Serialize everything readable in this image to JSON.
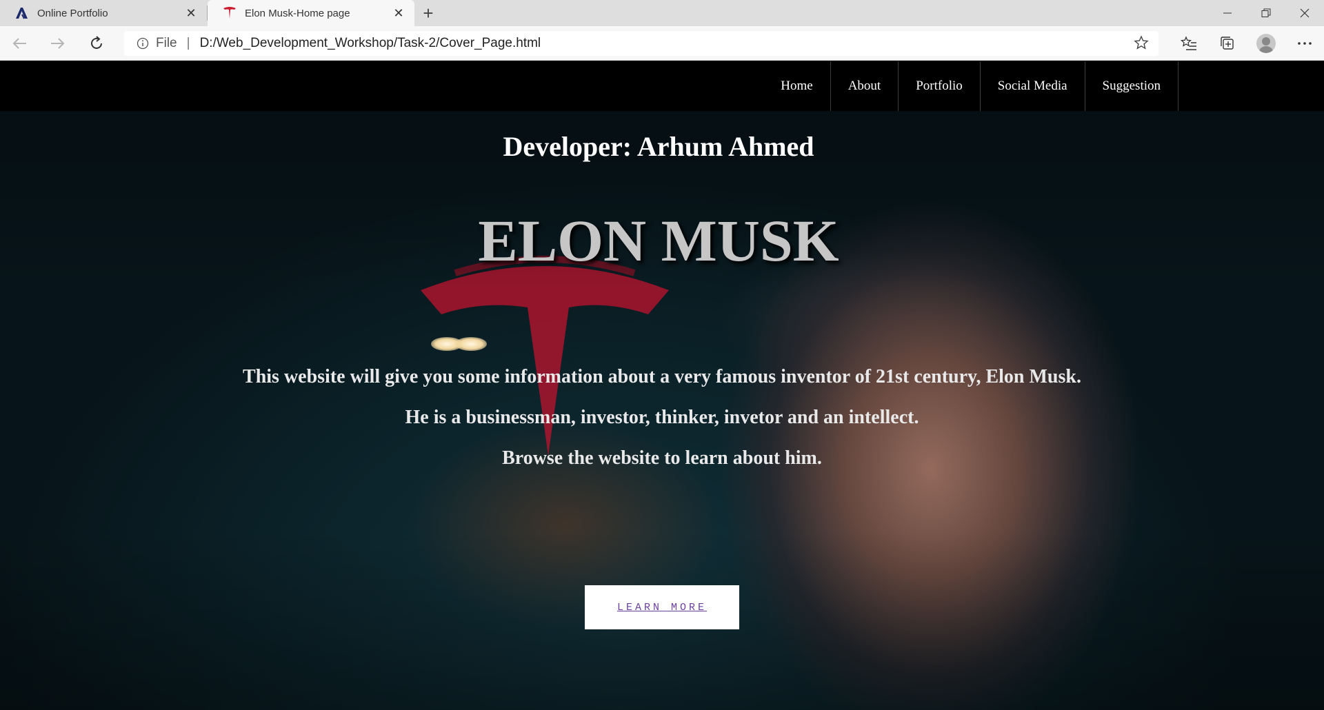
{
  "browser": {
    "tabs": [
      {
        "title": "Online Portfolio",
        "active": false
      },
      {
        "title": "Elon Musk-Home page",
        "active": true
      }
    ],
    "address": {
      "scheme_label": "File",
      "url": "D:/Web_Development_Workshop/Task-2/Cover_Page.html"
    }
  },
  "nav": {
    "items": [
      "Home",
      "About",
      "Portfolio",
      "Social Media",
      "Suggestion"
    ]
  },
  "hero": {
    "developer": "Developer: Arhum Ahmed",
    "title": "ELON MUSK",
    "line1": "This website will give you some information about a very famous inventor of 21st century, Elon Musk.",
    "line2": "He is a businessman, investor, thinker, invetor and an intellect.",
    "line3": "Browse the website to learn about him.",
    "button": "LEARN MORE"
  },
  "colors": {
    "tesla_red": "#b3142e",
    "button_text": "#6b3fa0"
  }
}
